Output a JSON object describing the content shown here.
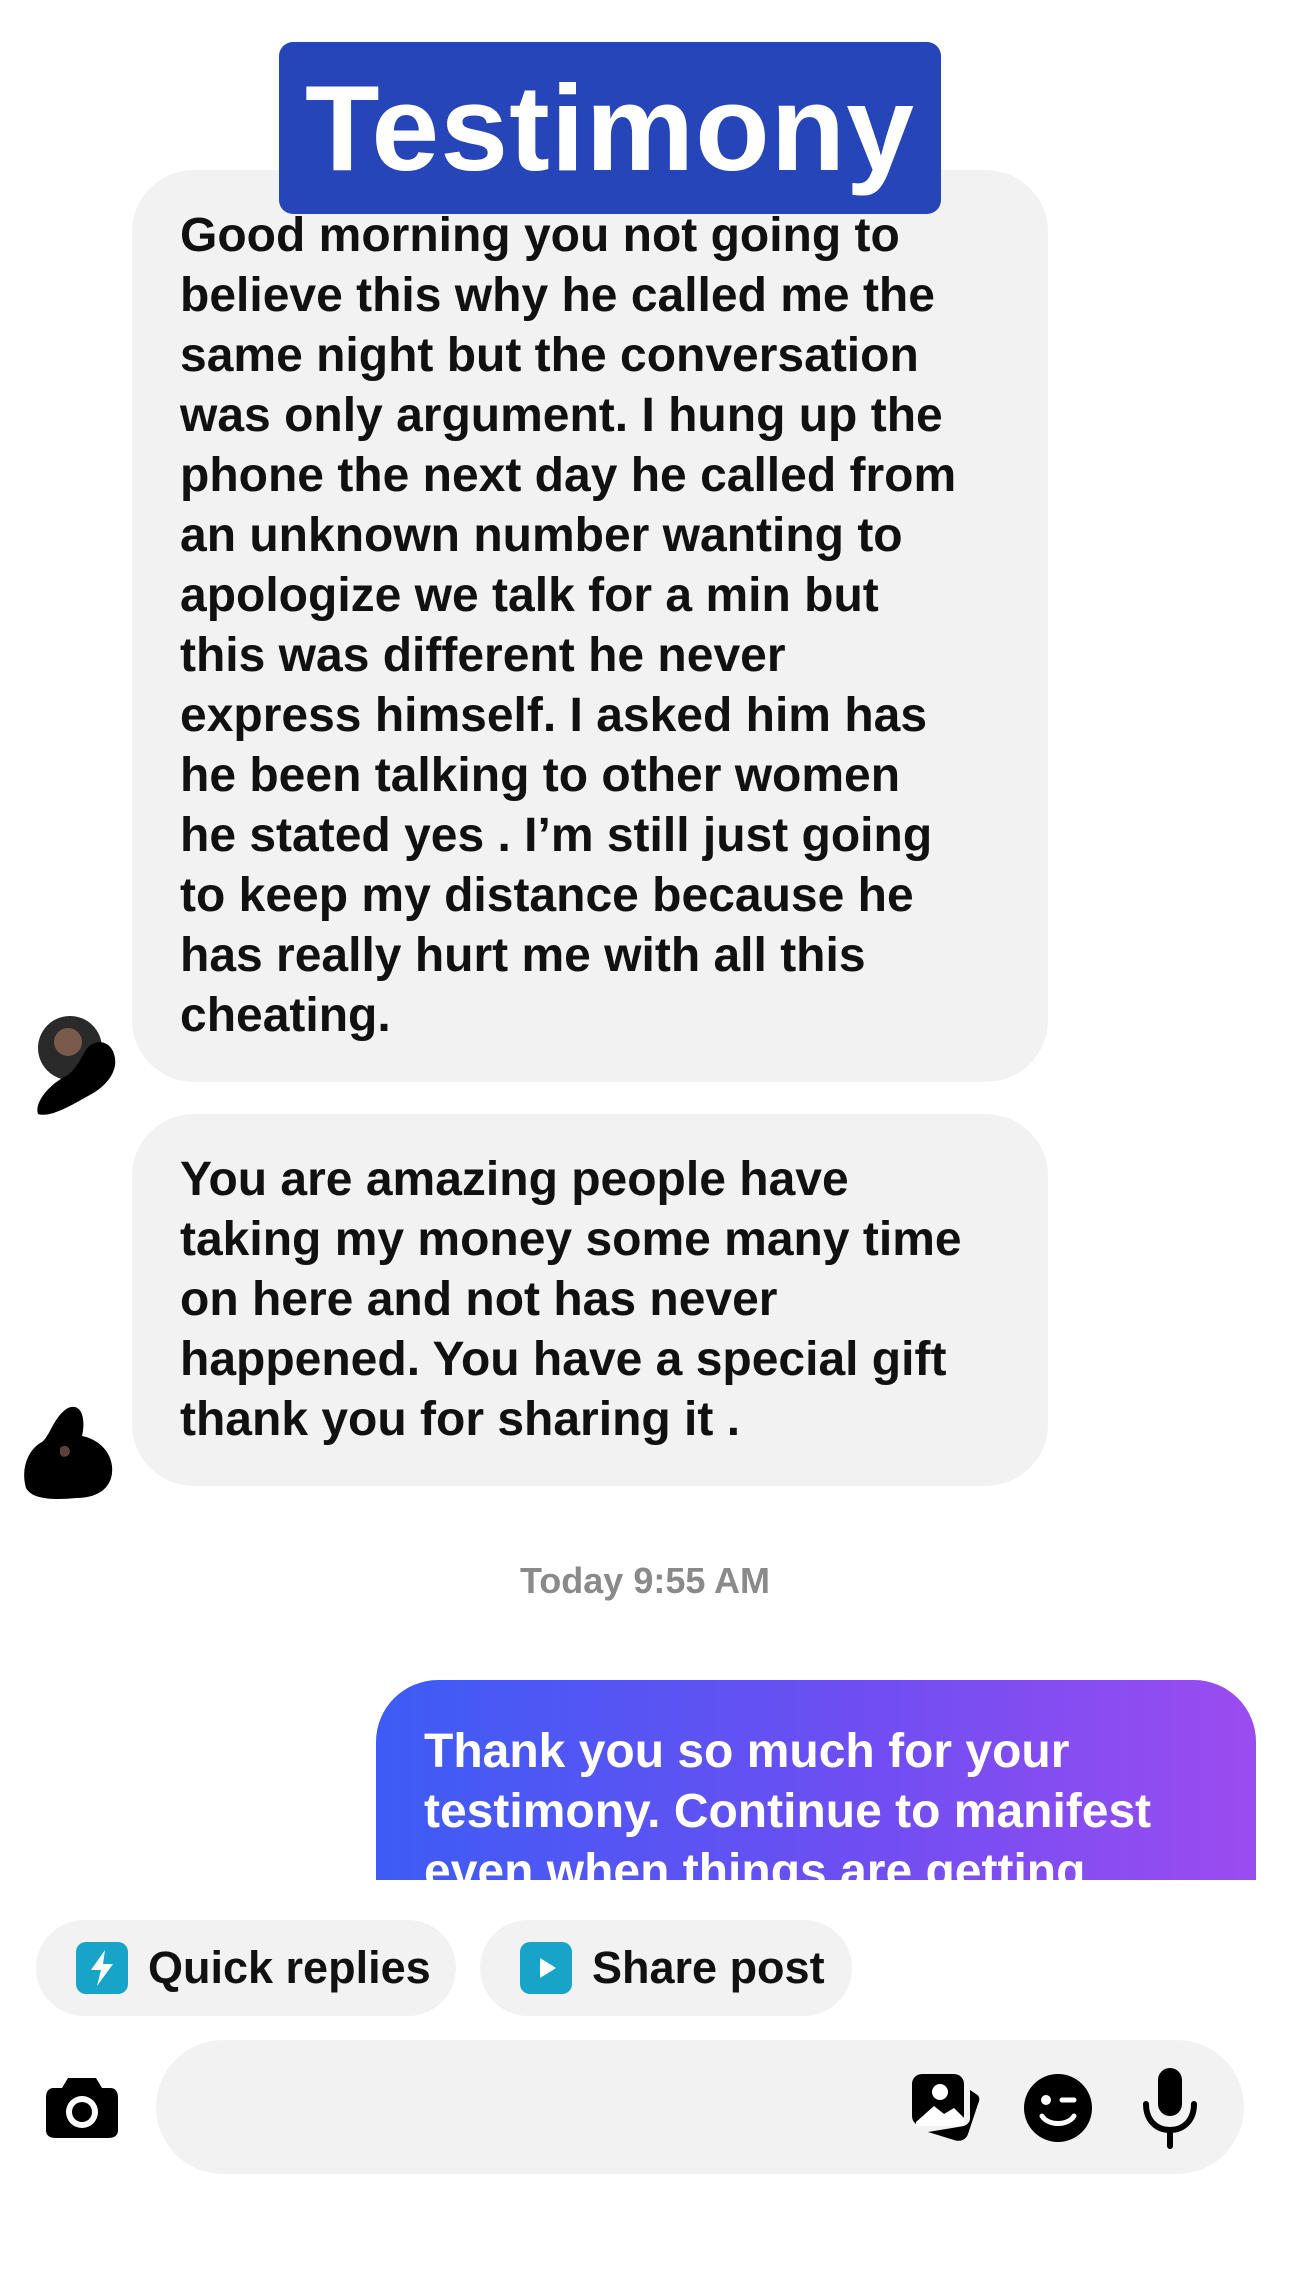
{
  "header": {
    "title": "Testimony"
  },
  "messages": [
    {
      "id": "msg-1",
      "direction": "incoming",
      "text": "Good morning you not going to\nbelieve this  why he called me the\nsame night but the conversation\nwas only argument. I hung up the\nphone the next day he called from\nan unknown number wanting to\napologize we talk for a min but\nthis was different he never\nexpress himself. I asked him has\nhe been talking to other women\nhe stated yes . I’m still just going\nto keep my distance because he\nhas really hurt me with all this\ncheating."
    },
    {
      "id": "msg-2",
      "direction": "incoming",
      "text": "You are amazing people have\ntaking my money some many time\non here and not has never\nhappened. You have a special gift\nthank you for sharing it ."
    }
  ],
  "timestamp": "Today 9:55 AM",
  "outgoing": {
    "line1": "Thank you so much for your",
    "line2": "testimony.  Continue to manifest",
    "line3": "even when things are getting"
  },
  "quick_actions": {
    "quick_replies": "Quick replies",
    "share_post": "Share post"
  },
  "composer": {
    "icons": [
      "camera-icon",
      "gallery-icon",
      "sticker-icon",
      "microphone-icon"
    ]
  },
  "colors": {
    "title_bg": "#2545b8",
    "incoming_bubble": "#f2f2f2",
    "outgoing_gradient_start": "#3d5cf5",
    "outgoing_gradient_end": "#9b4cf0",
    "chip_icon": "#18a3c8"
  }
}
